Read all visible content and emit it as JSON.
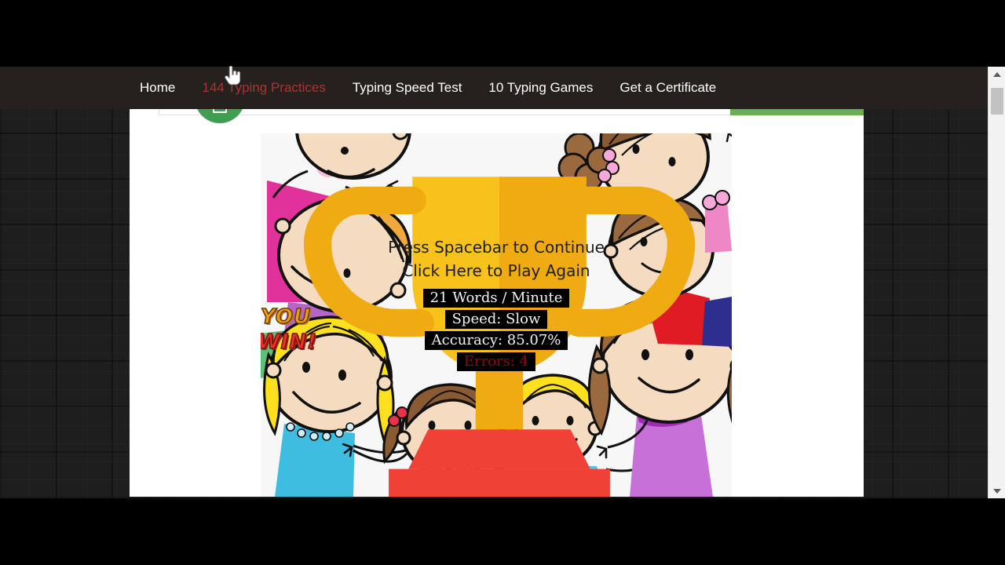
{
  "nav": {
    "items": [
      {
        "label": "Home",
        "active": false
      },
      {
        "label": "144 Typing Practices",
        "active": true
      },
      {
        "label": "Typing Speed Test",
        "active": false
      },
      {
        "label": "10 Typing Games",
        "active": false
      },
      {
        "label": "Get a Certificate",
        "active": false
      }
    ],
    "background_color": "#26211f",
    "active_color": "#a8352f",
    "link_color": "#ffffff"
  },
  "toolbar": {
    "print_icon": "printer-icon",
    "print_badge_color": "#3f9e52",
    "action_button_color": "#6ab04f",
    "action_button_label": ""
  },
  "result": {
    "win_title_line1": "YOU",
    "win_title_line2": "WIN!",
    "win_line1_color": "#f0a000",
    "win_line2_color": "#e8332a",
    "trophy_icon": "trophy-icon",
    "prompt_primary": "Press Spacebar to Continue",
    "prompt_secondary": "Click Here to Play Again",
    "stats": [
      {
        "id": "wpm",
        "text": "21 Words / Minute",
        "color": "#f2f2f2"
      },
      {
        "id": "speed",
        "text": "Speed: Slow",
        "color": "#f2f2f2"
      },
      {
        "id": "accuracy",
        "text": "Accuracy: 85.07%",
        "color": "#f2f2f2"
      },
      {
        "id": "errors",
        "text": "Errors: 4",
        "color": "#8d0b0b"
      }
    ],
    "illustration_alt": "children-holding-hands-illustration",
    "illustration_background": "#f7f7f7"
  },
  "scrollbar": {
    "up_arrow": "scroll-up-arrow",
    "down_arrow": "scroll-down-arrow",
    "thumb": "scroll-thumb"
  },
  "cursor": {
    "type": "pointing-hand-cursor"
  }
}
